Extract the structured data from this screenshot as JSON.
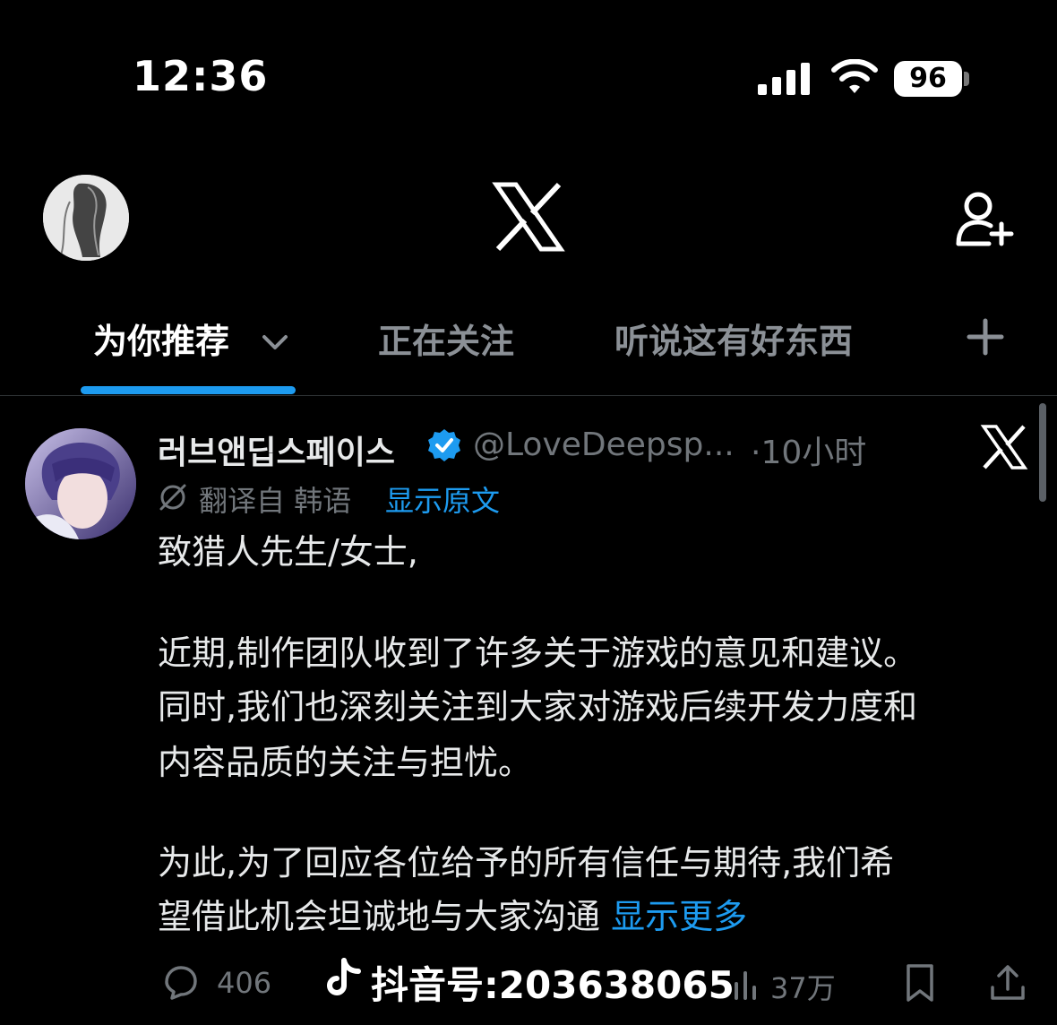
{
  "status_bar": {
    "time": "12:36",
    "battery": "96"
  },
  "tabs": [
    {
      "label": "为你推荐"
    },
    {
      "label": "正在关注"
    },
    {
      "label": "听说这有好东西"
    }
  ],
  "post": {
    "display_name": "러브앤딥스페이스",
    "handle": "@LoveDeepsp...",
    "time": "·10小时",
    "translated_from": "翻译自 韩语",
    "show_original": "显示原文",
    "paragraphs": [
      "致猎人先生/女士,",
      "近期,制作团队收到了许多关于游戏的意见和建议。",
      "同时,我们也深刻关注到大家对游戏后续开发力度和",
      "内容品质的关注与担忧。",
      "为此,为了回应各位给予的所有信任与期待,我们希",
      "望借此机会坦诚地与大家沟通"
    ],
    "show_more": "显示更多",
    "replies": "406",
    "views": "37万"
  },
  "watermark": "抖音号:203638065",
  "colors": {
    "accent": "#1d9bf0",
    "background": "#000000",
    "muted": "#71767b"
  }
}
